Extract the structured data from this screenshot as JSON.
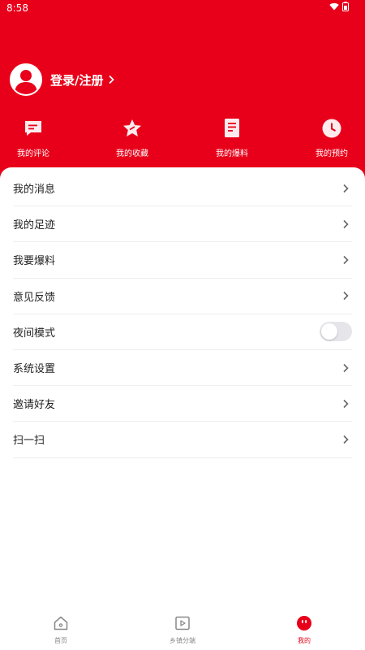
{
  "status_bar": {
    "time": "8:58"
  },
  "profile": {
    "login_label": "登录/注册"
  },
  "quick_actions": [
    {
      "label": "我的评论",
      "icon": "comment-icon"
    },
    {
      "label": "我的收藏",
      "icon": "star-icon"
    },
    {
      "label": "我的爆料",
      "icon": "document-icon"
    },
    {
      "label": "我的预约",
      "icon": "clock-icon"
    }
  ],
  "menu": [
    {
      "label": "我的消息"
    },
    {
      "label": "我的足迹"
    },
    {
      "label": "我要爆料"
    },
    {
      "label": "意见反馈"
    },
    {
      "label": "夜间模式",
      "control": "toggle",
      "value": "off"
    },
    {
      "label": "系统设置"
    },
    {
      "label": "邀请好友"
    },
    {
      "label": "扫一扫"
    }
  ],
  "bottom_nav": [
    {
      "label": "首页",
      "icon": "home-icon"
    },
    {
      "label": "乡镇分端",
      "icon": "video-icon"
    },
    {
      "label": "我的",
      "icon": "mine-icon",
      "active": true
    }
  ],
  "colors": {
    "brand": "#e8001a",
    "divider": "#eeeeee",
    "text": "#222222"
  }
}
